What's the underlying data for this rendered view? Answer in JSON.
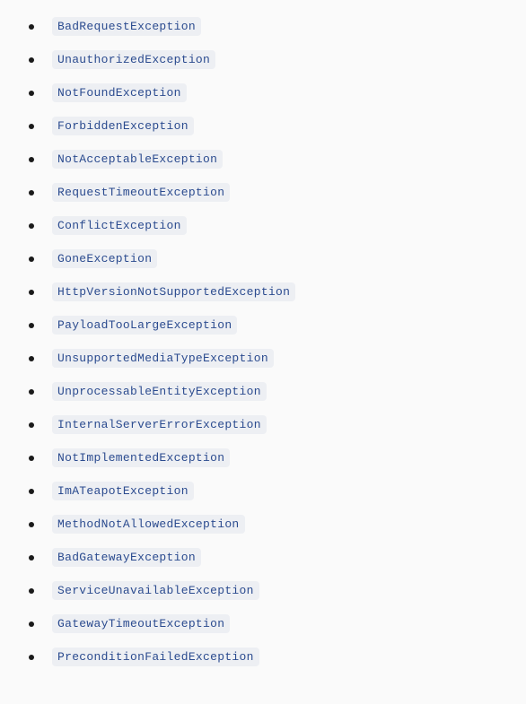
{
  "exceptions": [
    "BadRequestException",
    "UnauthorizedException",
    "NotFoundException",
    "ForbiddenException",
    "NotAcceptableException",
    "RequestTimeoutException",
    "ConflictException",
    "GoneException",
    "HttpVersionNotSupportedException",
    "PayloadTooLargeException",
    "UnsupportedMediaTypeException",
    "UnprocessableEntityException",
    "InternalServerErrorException",
    "NotImplementedException",
    "ImATeapotException",
    "MethodNotAllowedException",
    "BadGatewayException",
    "ServiceUnavailableException",
    "GatewayTimeoutException",
    "PreconditionFailedException"
  ]
}
